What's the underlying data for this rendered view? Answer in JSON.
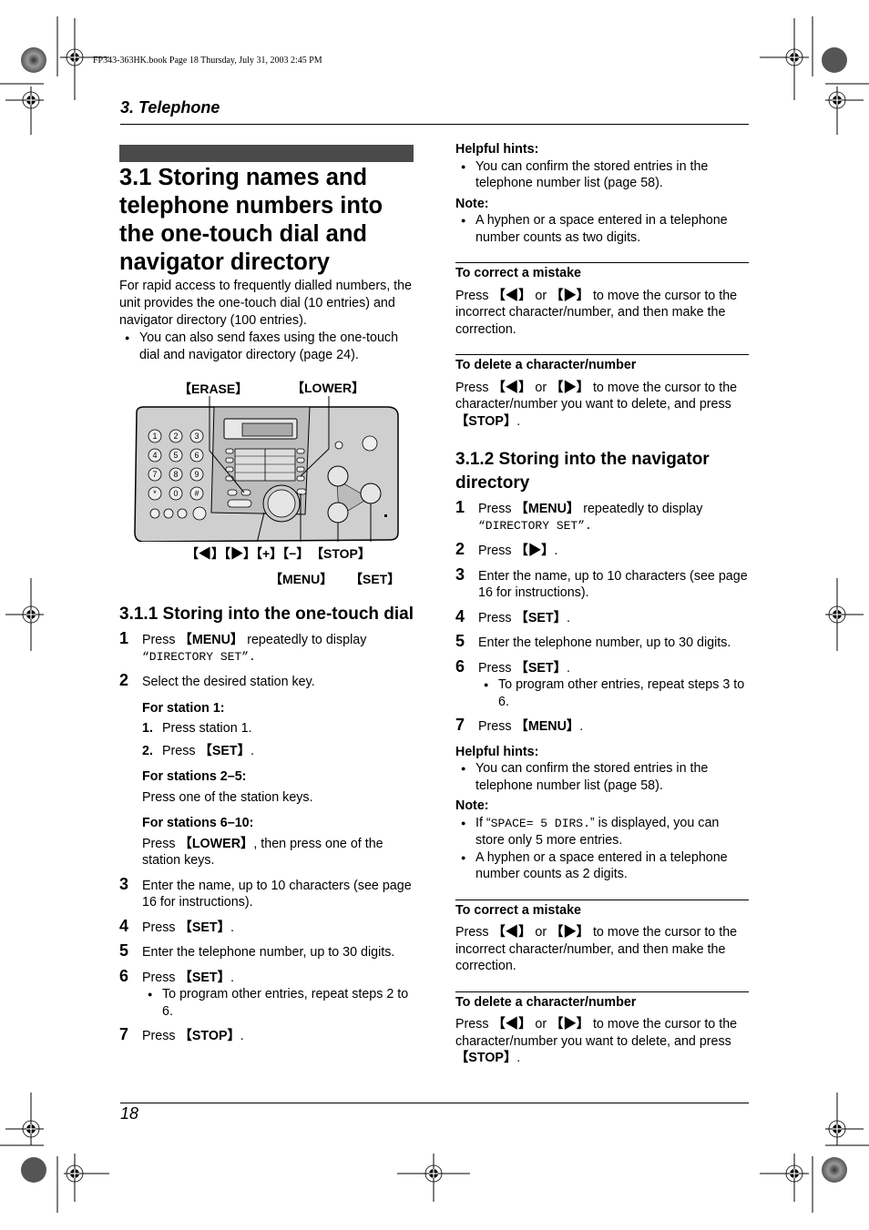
{
  "header": {
    "file_stamp": "FP343-363HK.book  Page 18  Thursday, July 31, 2003  2:45 PM",
    "chapter": "3. Telephone"
  },
  "footer": {
    "page_number": "18"
  },
  "left": {
    "title": "3.1 Storing names and telephone numbers into the one-touch dial and navigator directory",
    "intro": "For rapid access to frequently dialled numbers, the unit provides the one-touch dial (10 entries) and navigator directory (100 entries).",
    "intro_bullet": "You can also send faxes using the one-touch dial and navigator directory (page 24).",
    "diagram": {
      "erase": "【ERASE】",
      "lower": "【LOWER】",
      "nav": "【◀】【▶】【+】【−】",
      "stop": "【STOP】",
      "menu": "【MENU】",
      "set": "【SET】",
      "keypad": [
        "1",
        "2",
        "3",
        "4",
        "5",
        "6",
        "7",
        "8",
        "9",
        "*",
        "0",
        "#"
      ]
    },
    "section_311": {
      "heading": "3.1.1 Storing into the one-touch dial",
      "steps": [
        {
          "num": "1",
          "pre": "Press ",
          "key": "【MENU】",
          "post": " repeatedly to display",
          "mono_line": "“DIRECTORY SET”."
        },
        {
          "num": "2",
          "text": "Select the desired station key."
        },
        {
          "num": "3",
          "text": "Enter the name, up to 10 characters (see page 16 for instructions)."
        },
        {
          "num": "4",
          "pre": "Press ",
          "key": "【SET】",
          "post": "."
        },
        {
          "num": "5",
          "text": "Enter the telephone number, up to 30 digits."
        },
        {
          "num": "6",
          "pre": "Press ",
          "key": "【SET】",
          "post": ".",
          "bullet": "To program other entries, repeat steps 2 to 6."
        },
        {
          "num": "7",
          "pre": "Press ",
          "key": "【STOP】",
          "post": "."
        }
      ],
      "station1_label": "For station 1:",
      "station1_sub": [
        {
          "num": "1.",
          "text": "Press station 1."
        },
        {
          "num": "2.",
          "pre": "Press ",
          "key": "【SET】",
          "post": "."
        }
      ],
      "stations25_label": "For stations 2–5:",
      "stations25_text": "Press one of the station keys.",
      "stations610_label": "For stations 6–10:",
      "stations610_pre": "Press ",
      "stations610_key": "【LOWER】",
      "stations610_post": ", then press one of the station keys."
    }
  },
  "right": {
    "hints1_label": "Helpful hints:",
    "hints1_bullet": "You can confirm the stored entries in the telephone number list (page 58).",
    "note1_label": "Note:",
    "note1_bullet": "A hyphen or a space entered in a telephone number counts as two digits.",
    "correct1_heading": "To correct a mistake",
    "correct1_pre": "Press ",
    "left_key": "【◀】",
    "or": " or ",
    "right_key": "【▶】",
    "correct1_post": " to move the cursor to the incorrect character/number, and then make the correction.",
    "delete1_heading": "To delete a character/number",
    "delete1_post": " to move the cursor to the character/number you want to delete, and press ",
    "stop_key": "【STOP】",
    "period": ".",
    "section_312": {
      "heading": "3.1.2 Storing into the navigator directory",
      "steps": [
        {
          "num": "1",
          "pre": "Press ",
          "key": "【MENU】",
          "post": " repeatedly to display",
          "mono_line": "“DIRECTORY SET”."
        },
        {
          "num": "2",
          "pre": "Press ",
          "key": "【▶】",
          "post": "."
        },
        {
          "num": "3",
          "text": "Enter the name, up to 10 characters (see page 16 for instructions)."
        },
        {
          "num": "4",
          "pre": "Press ",
          "key": "【SET】",
          "post": "."
        },
        {
          "num": "5",
          "text": "Enter the telephone number, up to 30 digits."
        },
        {
          "num": "6",
          "pre": "Press ",
          "key": "【SET】",
          "post": ".",
          "bullet": "To program other entries, repeat steps 3 to 6."
        },
        {
          "num": "7",
          "pre": "Press ",
          "key": "【MENU】",
          "post": "."
        }
      ]
    },
    "hints2_label": "Helpful hints:",
    "hints2_bullet": "You can confirm the stored entries in the telephone number list (page 58).",
    "note2_label": "Note:",
    "note2_bullet1_pre": "If “",
    "note2_bullet1_mono": "SPACE= 5 DIRS.",
    "note2_bullet1_post": "” is displayed, you can store only 5 more entries.",
    "note2_bullet2": "A hyphen or a space entered in a telephone number counts as 2 digits.",
    "correct2_heading": "To correct a mistake",
    "delete2_heading": "To delete a character/number"
  }
}
